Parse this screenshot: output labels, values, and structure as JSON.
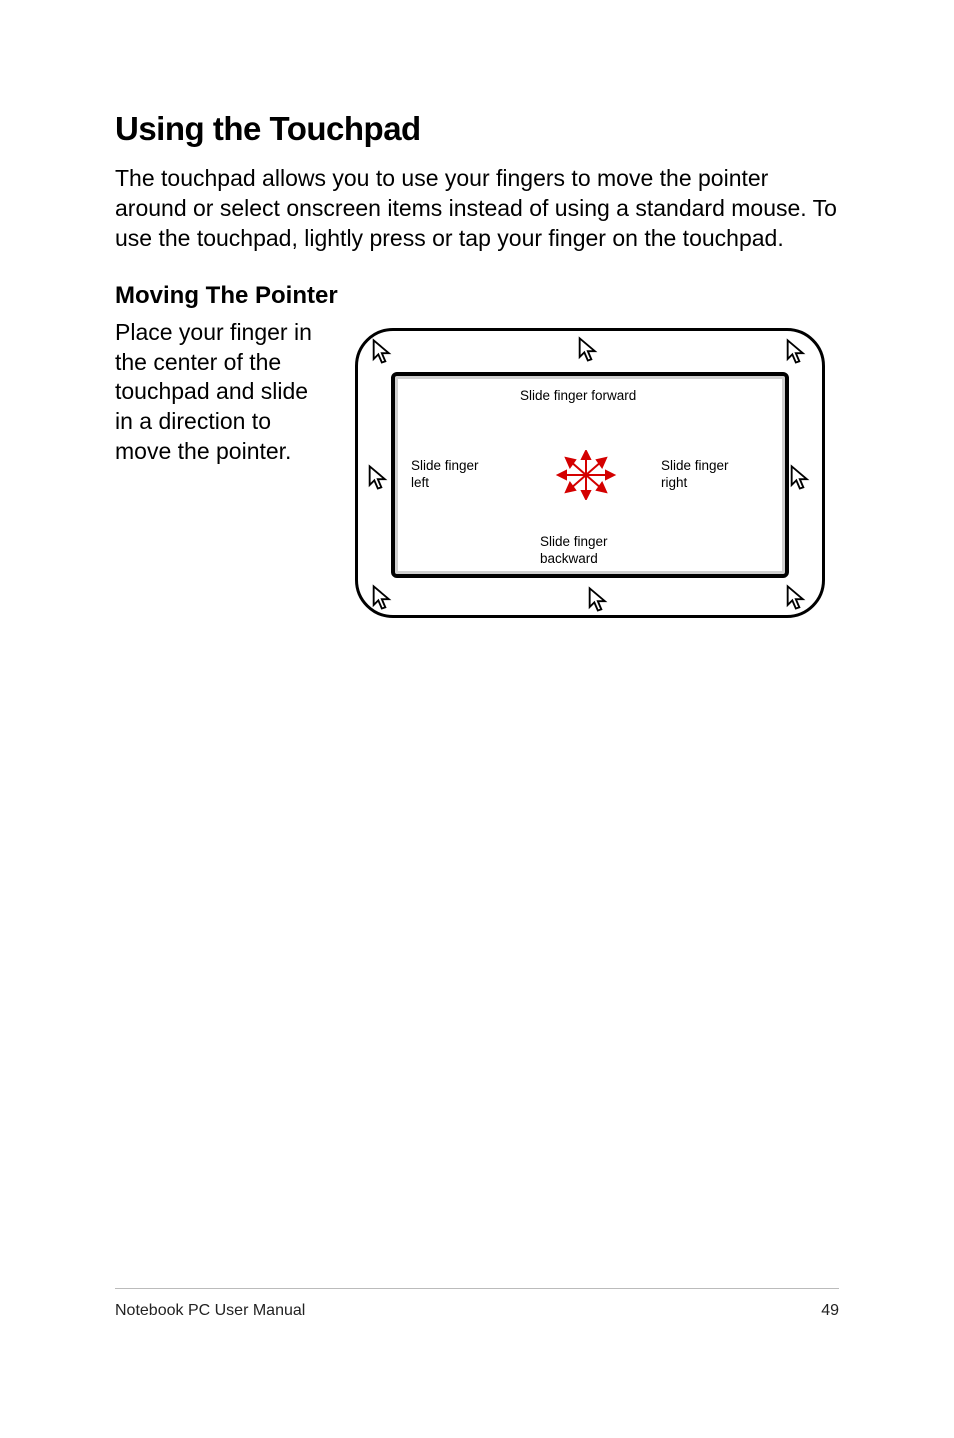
{
  "title": "Using the Touchpad",
  "intro": "The touchpad allows you to use your fingers to move the pointer around or select onscreen items instead of using a standard mouse. To use the touchpad, lightly press or tap your finger on the touchpad.",
  "section_heading": "Moving The Pointer",
  "side_text": "Place your finger in the center of the touchpad and slide in a direction to move the pointer.",
  "diagram": {
    "label_forward": "Slide finger forward",
    "label_left_l1": "Slide finger",
    "label_left_l2": "left",
    "label_right_l1": "Slide finger",
    "label_right_l2": "right",
    "label_back_l1": "Slide finger",
    "label_back_l2": "backward"
  },
  "footer": {
    "left": "Notebook PC User Manual",
    "right": "49"
  }
}
